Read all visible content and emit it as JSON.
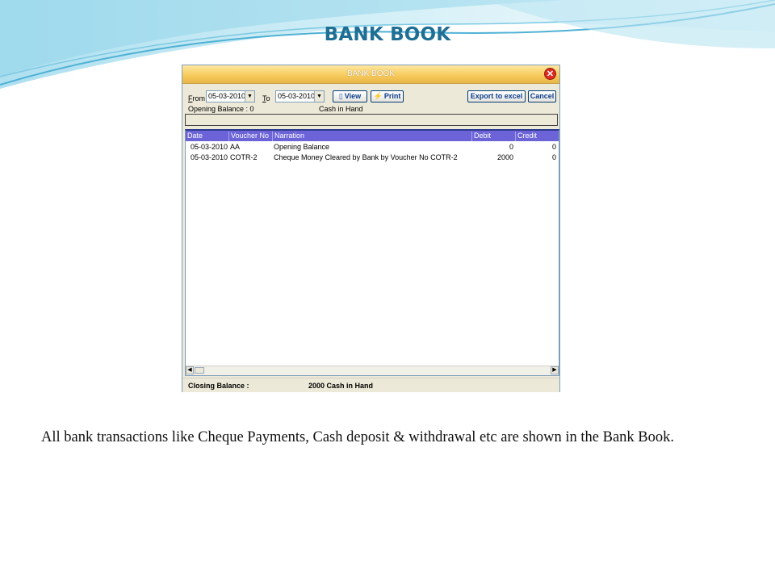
{
  "slide": {
    "title": "BANK BOOK",
    "caption": "All bank transactions like Cheque Payments, Cash deposit & withdrawal etc are shown in the Bank Book."
  },
  "window": {
    "title": "BANK BOOK",
    "close_icon": "close-icon",
    "from_label": "F",
    "from_label_rest": "rom",
    "from_date": "05-03-2010",
    "to_label": "T",
    "to_label_rest": "o",
    "to_date": "05-03-2010",
    "view_label": "View",
    "print_label": "Print",
    "export_label": "Export to excel",
    "cancel_label": "Cancel",
    "opening_balance_label": "Opening Balance : 0",
    "cash_in_hand_label": "Cash in Hand"
  },
  "table": {
    "columns": [
      "Date",
      "Voucher No",
      "Narration",
      "Debit",
      "Credit"
    ],
    "rows": [
      {
        "date": "05-03-2010",
        "voucher": "AA",
        "narration": "Opening Balance",
        "debit": "0",
        "credit": "0"
      },
      {
        "date": "05-03-2010",
        "voucher": "COTR-2",
        "narration": "Cheque Money Cleared by Bank by Voucher No COTR-2",
        "debit": "2000",
        "credit": "0"
      }
    ]
  },
  "status": {
    "closing_label": "Closing Balance :",
    "closing_value": "2000  Cash in Hand"
  },
  "colors": {
    "title": "#1f6f94",
    "grid_header": "#6c63d9",
    "titlebar": "#f6c95a"
  }
}
